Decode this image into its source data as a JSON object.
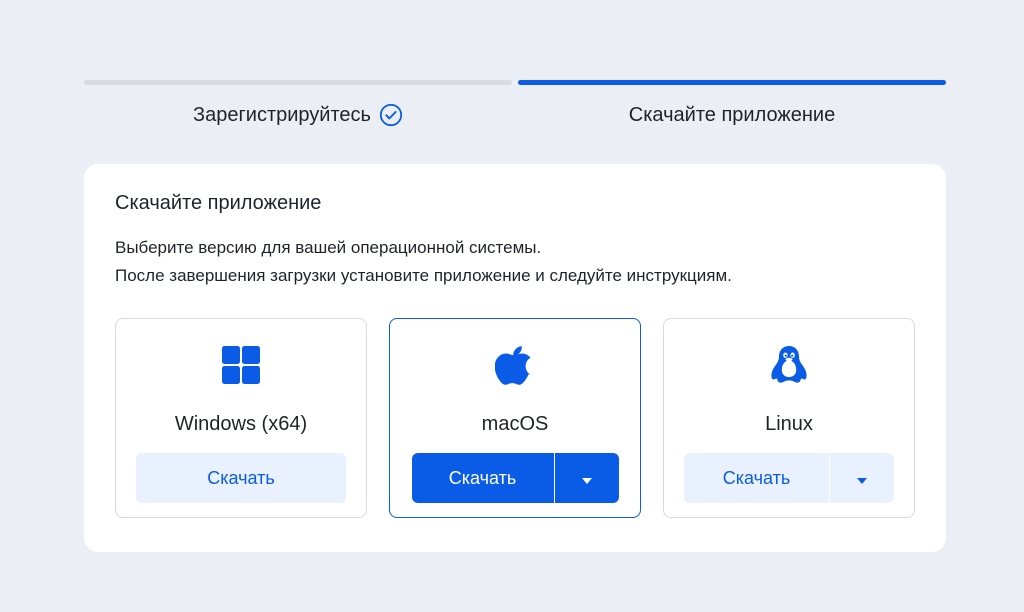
{
  "stepper": {
    "steps": [
      {
        "label": "Зарегистрируйтесь",
        "state": "done"
      },
      {
        "label": "Скачайте приложение",
        "state": "active"
      }
    ]
  },
  "card": {
    "title": "Скачайте приложение",
    "description_lines": [
      "Выберите версию для вашей операционной системы.",
      "После завершения загрузки установите приложение и следуйте инструкциям."
    ]
  },
  "os_options": [
    {
      "name": "Windows (x64)",
      "icon": "windows-icon",
      "button_label": "Скачать",
      "has_dropdown": false,
      "selected": false
    },
    {
      "name": "macOS",
      "icon": "apple-icon",
      "button_label": "Скачать",
      "has_dropdown": true,
      "selected": true
    },
    {
      "name": "Linux",
      "icon": "linux-icon",
      "button_label": "Скачать",
      "has_dropdown": true,
      "selected": false
    }
  ],
  "colors": {
    "accent": "#0a5ce6",
    "background": "#eceef5",
    "card": "#ffffff",
    "secondary_button_bg": "#eaf1fe"
  }
}
